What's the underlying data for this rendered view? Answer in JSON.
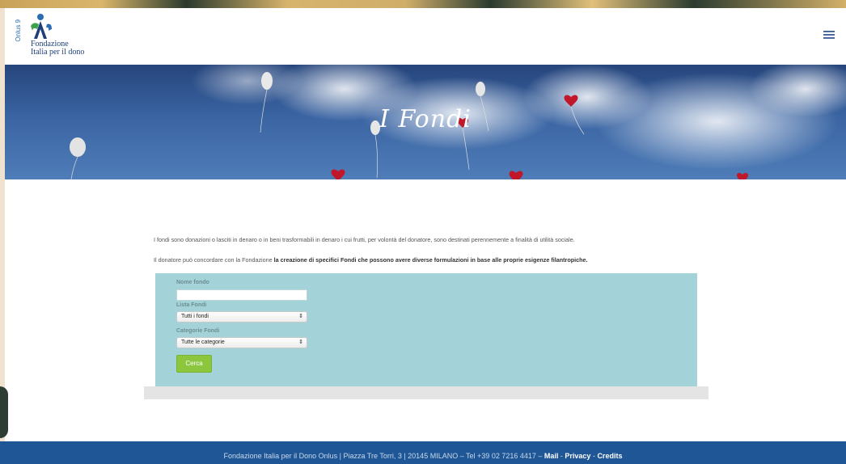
{
  "header": {
    "logo": {
      "vertical_text": "Onlus 9",
      "line1": "Fondazione",
      "line2": "Italia per il dono"
    },
    "menu_icon": "hamburger-menu-icon"
  },
  "hero": {
    "title": "I Fondi"
  },
  "content": {
    "intro_1": "I fondi sono donazioni o lasciti in denaro o in beni trasformabili in denaro i cui frutti, per volontà del donatore, sono destinati perennemente a finalità di utilità sociale.",
    "intro_2_prefix": "Il donatore può concordare con la Fondazione ",
    "intro_2_bold": "la creazione di specifici Fondi che possono avere diverse formulazioni in base alle proprie esigenze filantropiche."
  },
  "search": {
    "nome_fondo_label": "Nome fondo",
    "nome_fondo_value": "",
    "lista_fondi_label": "Lista Fondi",
    "lista_fondi_selected": "Tutti i fondi",
    "categorie_label": "Categorie Fondi",
    "categorie_selected": "Tutte le categorie",
    "submit_label": "Cerca",
    "select_arrow": "⇕"
  },
  "footer": {
    "text": "Fondazione Italia per il Dono Onlus | Piazza Tre Torri, 3 | 20145 MILANO – Tel +39 02 7216 4417 – ",
    "mail": "Mail",
    "sep1": " - ",
    "privacy": "Privacy",
    "sep2": " - ",
    "credits": "Credits"
  },
  "colors": {
    "footer_bg": "#1f5796",
    "panel_bg": "#a3d3d8",
    "button_bg": "#8cc63f",
    "hero_bg": "#3a64a2"
  }
}
